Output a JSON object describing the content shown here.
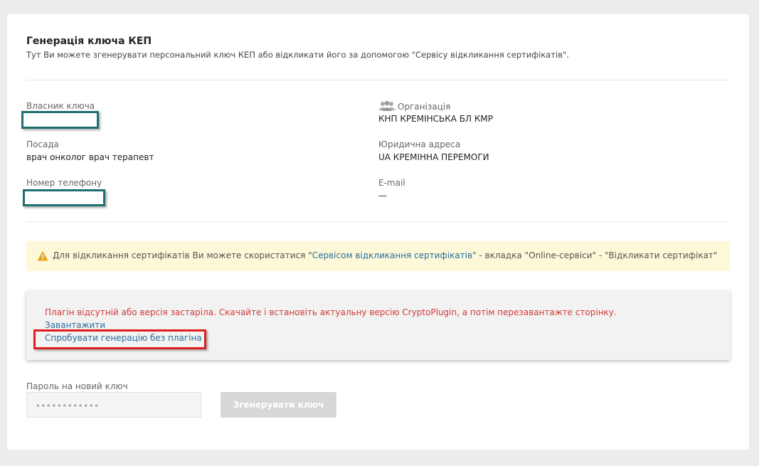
{
  "page": {
    "title": "Генерація ключа КЕП",
    "subtitle": "Тут Ви можете згенерувати персональний ключ КЕП або відкликати його за допомогою \"Сервісу відкликання сертифікатів\"."
  },
  "fields": {
    "owner_label": "Власник ключа",
    "position_label": "Посада",
    "position_value": "врач онколог врач терапевт",
    "phone_label": "Номер телефону",
    "org_label": "Організація",
    "org_value": "КНП КРЕМІНСЬКА БЛ КМР",
    "address_label": "Юридична адреса",
    "address_value": "UA КРЕМІННА ПЕРЕМОГИ",
    "email_label": "E-mail",
    "email_value": "—"
  },
  "warning": {
    "prefix": "Для відкликання сертифікатів Ви можете скористатися \"",
    "link": "Сервісом відкликання сертифікатів",
    "suffix": "\" - вкладка \"Online-сервіси\" - \"Відкликати сертифікат\""
  },
  "plugin": {
    "error": "Плагін відсутній або версія застаріла. Скачайте і встановіть актуальну версію CryptoPlugin, а потім перезавантажте сторінку.",
    "download_link": "Завантажити",
    "try_link": "Спробувати генерацію без плагіна"
  },
  "password": {
    "label": "Пароль на новий ключ",
    "masked_value": "••••••••••••",
    "button": "Згенерувати ключ"
  },
  "colors": {
    "link": "#2a6e9f",
    "error": "#d23a3a",
    "warning_bg": "#fcf8d8",
    "highlight": "#e01e1e",
    "redaction": "#1f6f6f"
  }
}
